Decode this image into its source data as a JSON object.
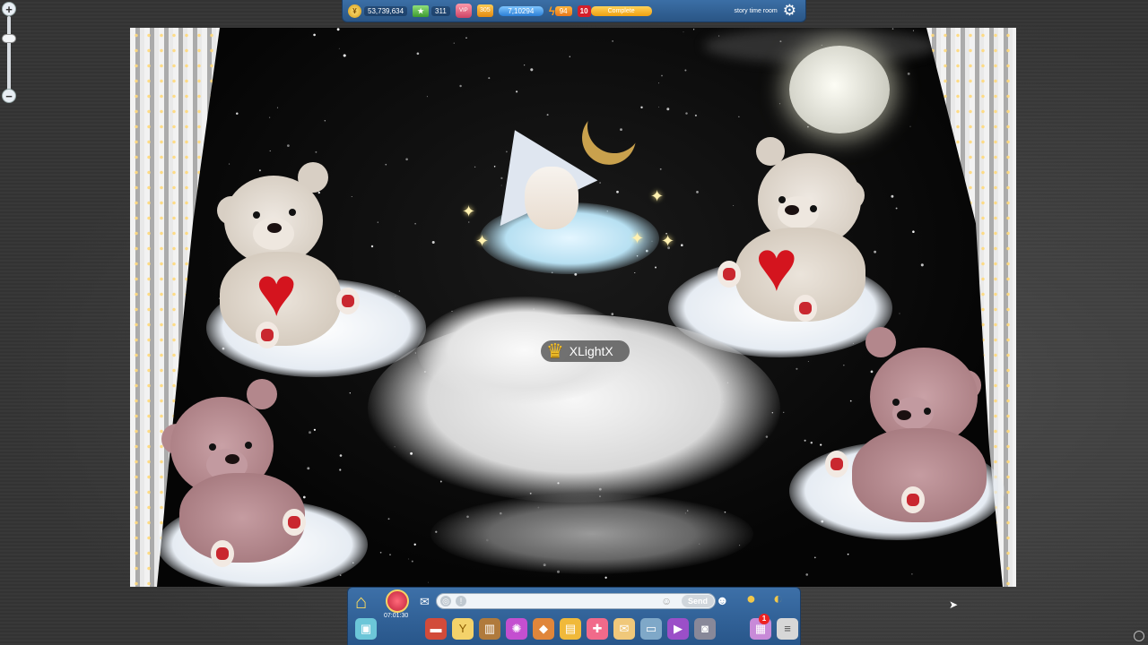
{
  "hud": {
    "coins": "53,739,634",
    "starcoins": "311",
    "diamonds": "305",
    "fame": "7,10294",
    "energy": "94",
    "level": "10",
    "level_status": "Complete",
    "room_name": "story time room"
  },
  "stage": {
    "player_name": "XLightX"
  },
  "toolbar": {
    "timer": "07:01:30",
    "chat_placeholder": "",
    "send_label": "Send",
    "notification_count": "1"
  },
  "colors": {
    "hud_bg": "#2f5f96",
    "accent_gold": "#f2c84b",
    "heart_red": "#d4141e"
  },
  "icons": {
    "zoom_in": "plus-icon",
    "zoom_out": "minus-icon",
    "settings": "gear-icon",
    "home": "house-icon",
    "send": "send-icon"
  }
}
